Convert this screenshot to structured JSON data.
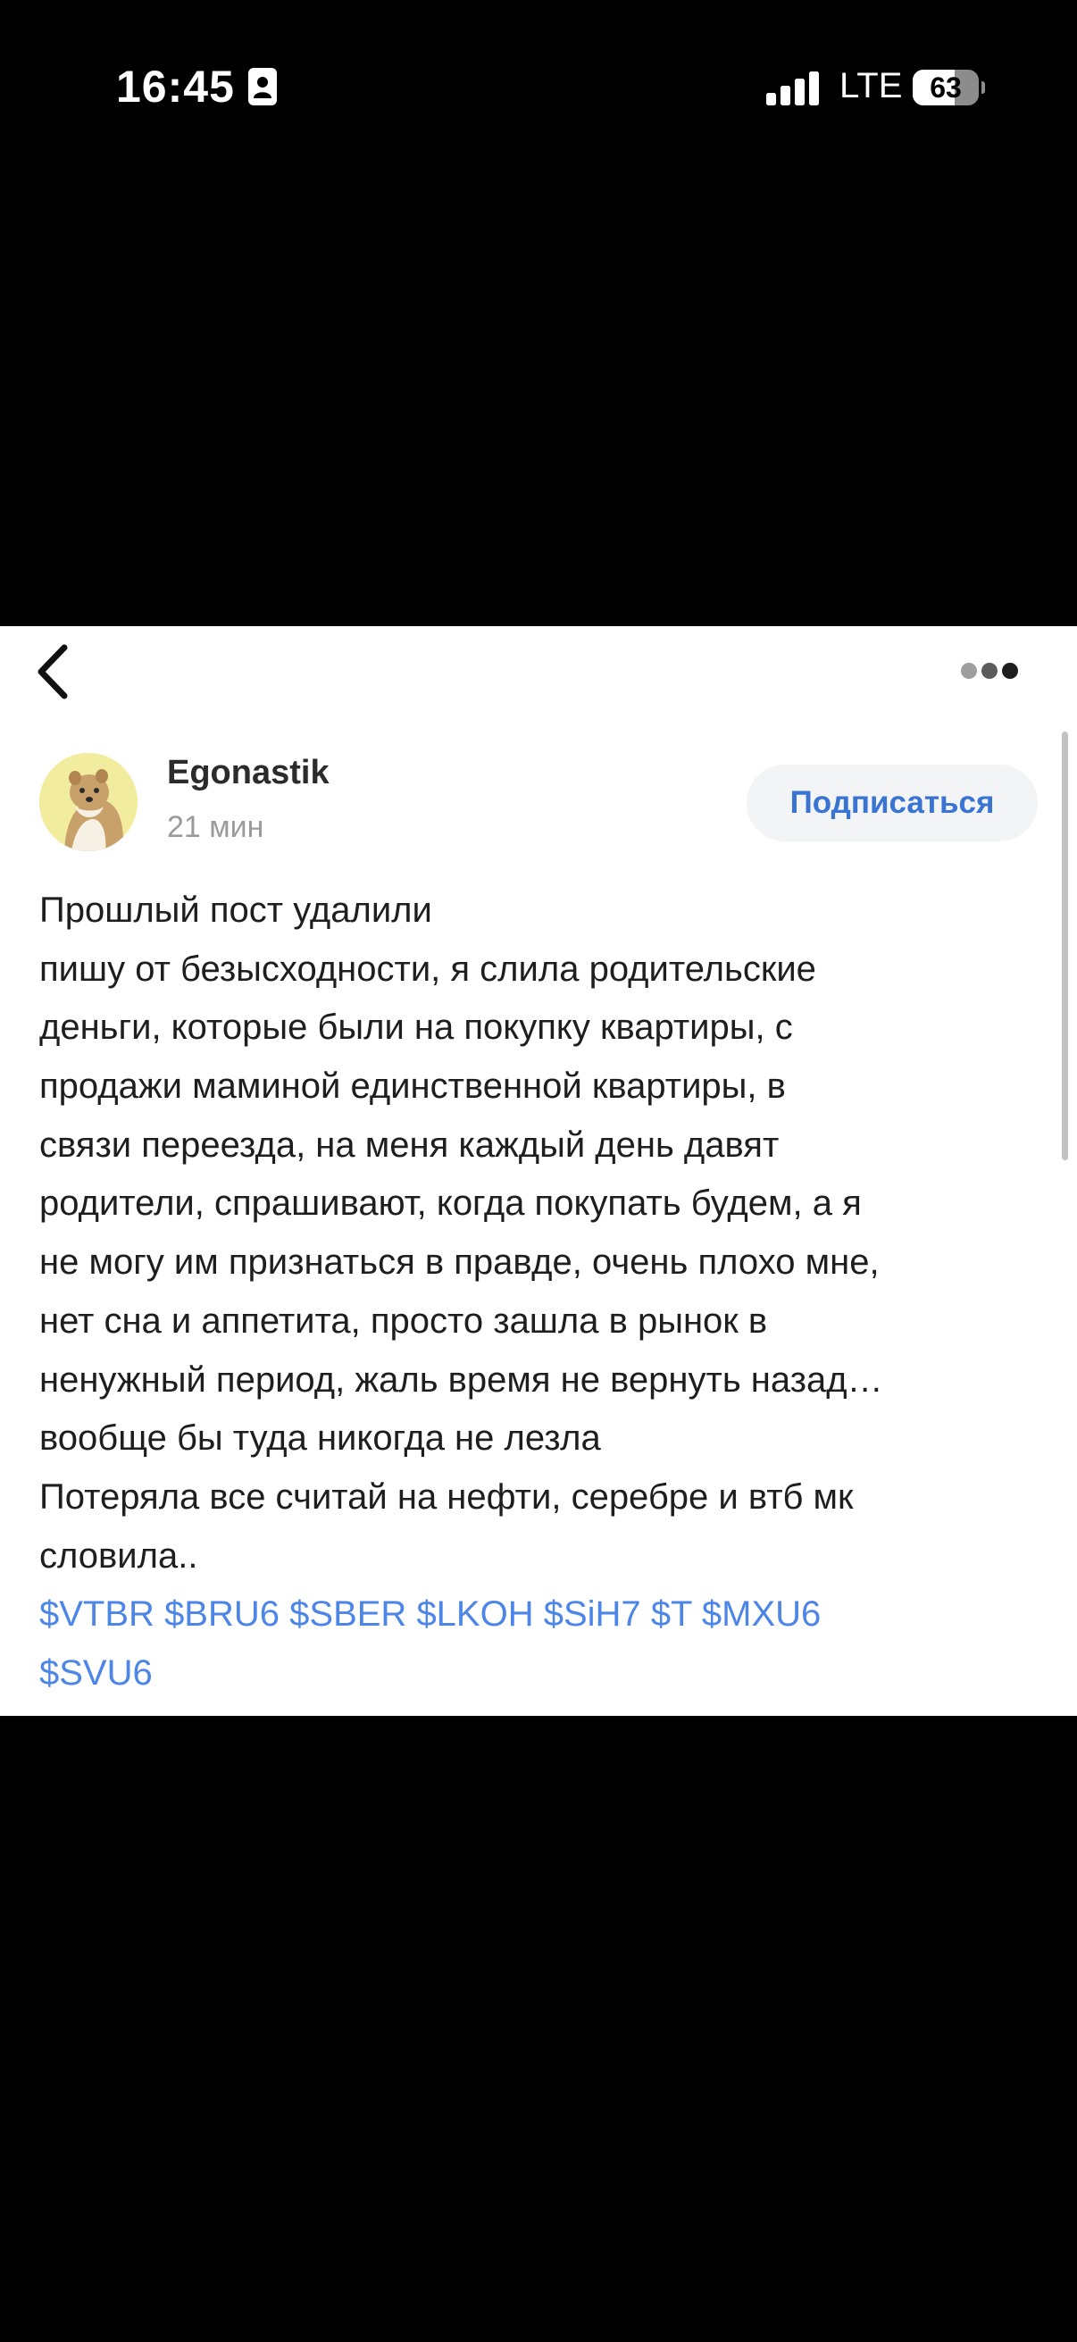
{
  "status_bar": {
    "time": "16:45",
    "network": "LTE",
    "battery_level": "63",
    "battery_fraction": 0.63,
    "icons": {
      "contact": "person-card-icon",
      "signal": "cellular-signal-icon",
      "battery": "battery-icon"
    }
  },
  "nav": {
    "back_icon": "chevron-left-icon",
    "more_icon": "more-dots-icon"
  },
  "post": {
    "author": "Egonastik",
    "time_ago": "21 мин",
    "subscribe_label": "Подписаться",
    "lines": [
      "Прошлый пост удалили",
      "пишу от безысходности, я слила родительские",
      "деньги, которые были на покупку квартиры, с",
      "продажи маминой единственной квартиры, в",
      "связи переезда, на меня каждый день давят",
      "родители, спрашивают, когда покупать будем, а я",
      "не могу им признаться в правде, очень плохо мне,",
      "нет сна и аппетита, просто зашла в рынок в",
      "ненужный период, жаль время не вернуть назад…",
      "вообще бы туда никогда не лезла",
      "Потеряла все считай на нефти, серебре и втб мк",
      "словила.."
    ],
    "tickers": [
      "$VTBR",
      "$BRU6",
      "$SBER",
      "$LKOH",
      "$SiH7",
      "$T",
      "$MXU6",
      "$SVU6"
    ]
  },
  "colors": {
    "link": "#4d86e6",
    "subscribe_text": "#3a74d3",
    "subscribe_bg": "#f3f4f6",
    "text": "#1e1e1e",
    "muted": "#9a9a9a",
    "background": "#000000",
    "card": "#ffffff"
  }
}
